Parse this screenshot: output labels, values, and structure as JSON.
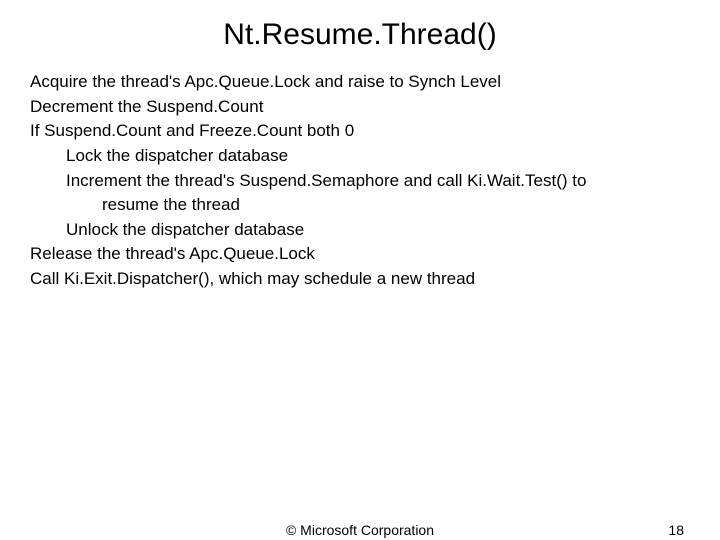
{
  "title": "Nt.Resume.Thread()",
  "lines": {
    "l0": "Acquire the thread's Apc.Queue.Lock and raise to Synch Level",
    "l1": "Decrement the Suspend.Count",
    "l2": "If Suspend.Count and Freeze.Count both 0",
    "l3": "Lock the dispatcher database",
    "l4": "Increment the thread's Suspend.Semaphore and call Ki.Wait.Test() to",
    "l5": "resume the thread",
    "l6": "Unlock the dispatcher database",
    "l7": "Release the thread's Apc.Queue.Lock",
    "l8": "Call Ki.Exit.Dispatcher(), which may schedule a new thread"
  },
  "footer": {
    "copyright": "© Microsoft Corporation",
    "page": "18"
  }
}
